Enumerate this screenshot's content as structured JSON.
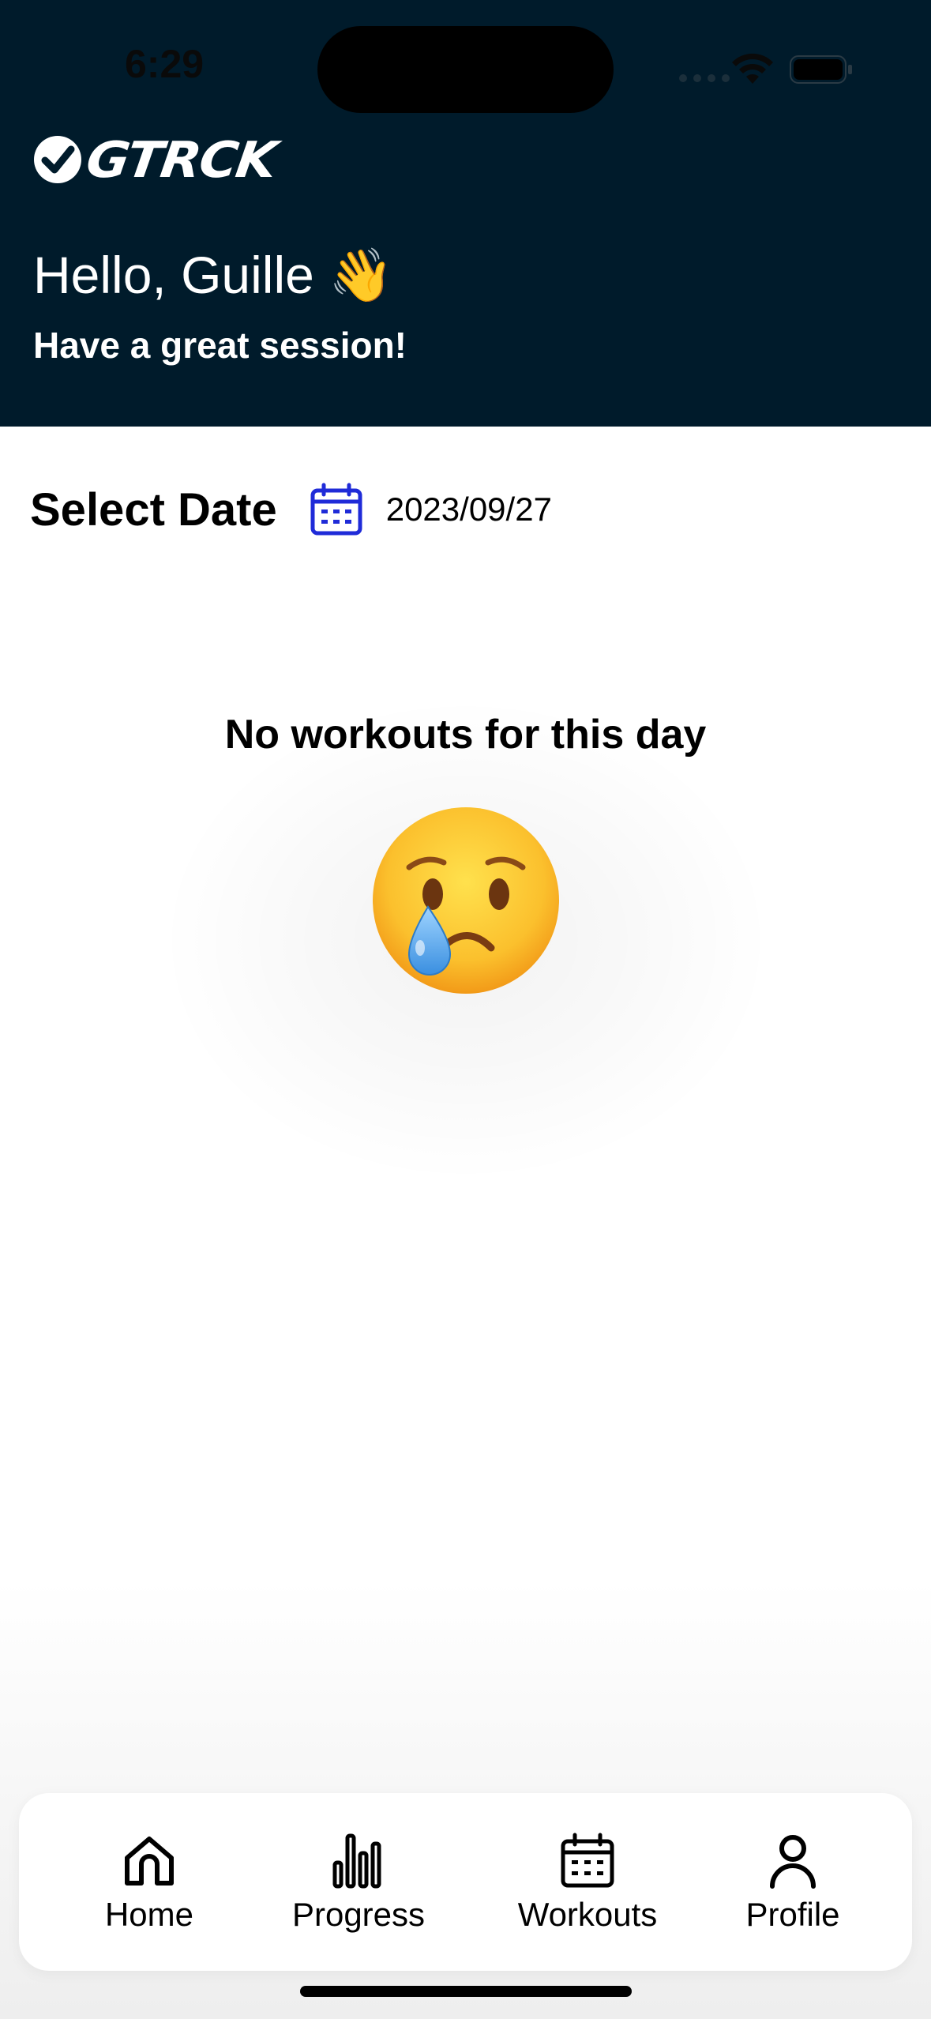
{
  "status_bar": {
    "time": "6:29"
  },
  "header": {
    "logo_text": "GTRCK",
    "greeting": "Hello, Guille 👋",
    "subtitle": "Have a great session!"
  },
  "date_picker": {
    "label": "Select Date",
    "value": "2023/09/27",
    "icon": "calendar-icon",
    "icon_color": "#1f2bd8"
  },
  "empty_state": {
    "message": "No workouts for this day",
    "icon": "crying-face-icon"
  },
  "tab_bar": {
    "tabs": [
      {
        "label": "Home",
        "icon": "home-icon"
      },
      {
        "label": "Progress",
        "icon": "bar-chart-icon"
      },
      {
        "label": "Workouts",
        "icon": "calendar-icon"
      },
      {
        "label": "Profile",
        "icon": "user-icon"
      }
    ]
  },
  "colors": {
    "header_bg": "#001b2b",
    "accent": "#1f2bd8",
    "text": "#000000"
  }
}
